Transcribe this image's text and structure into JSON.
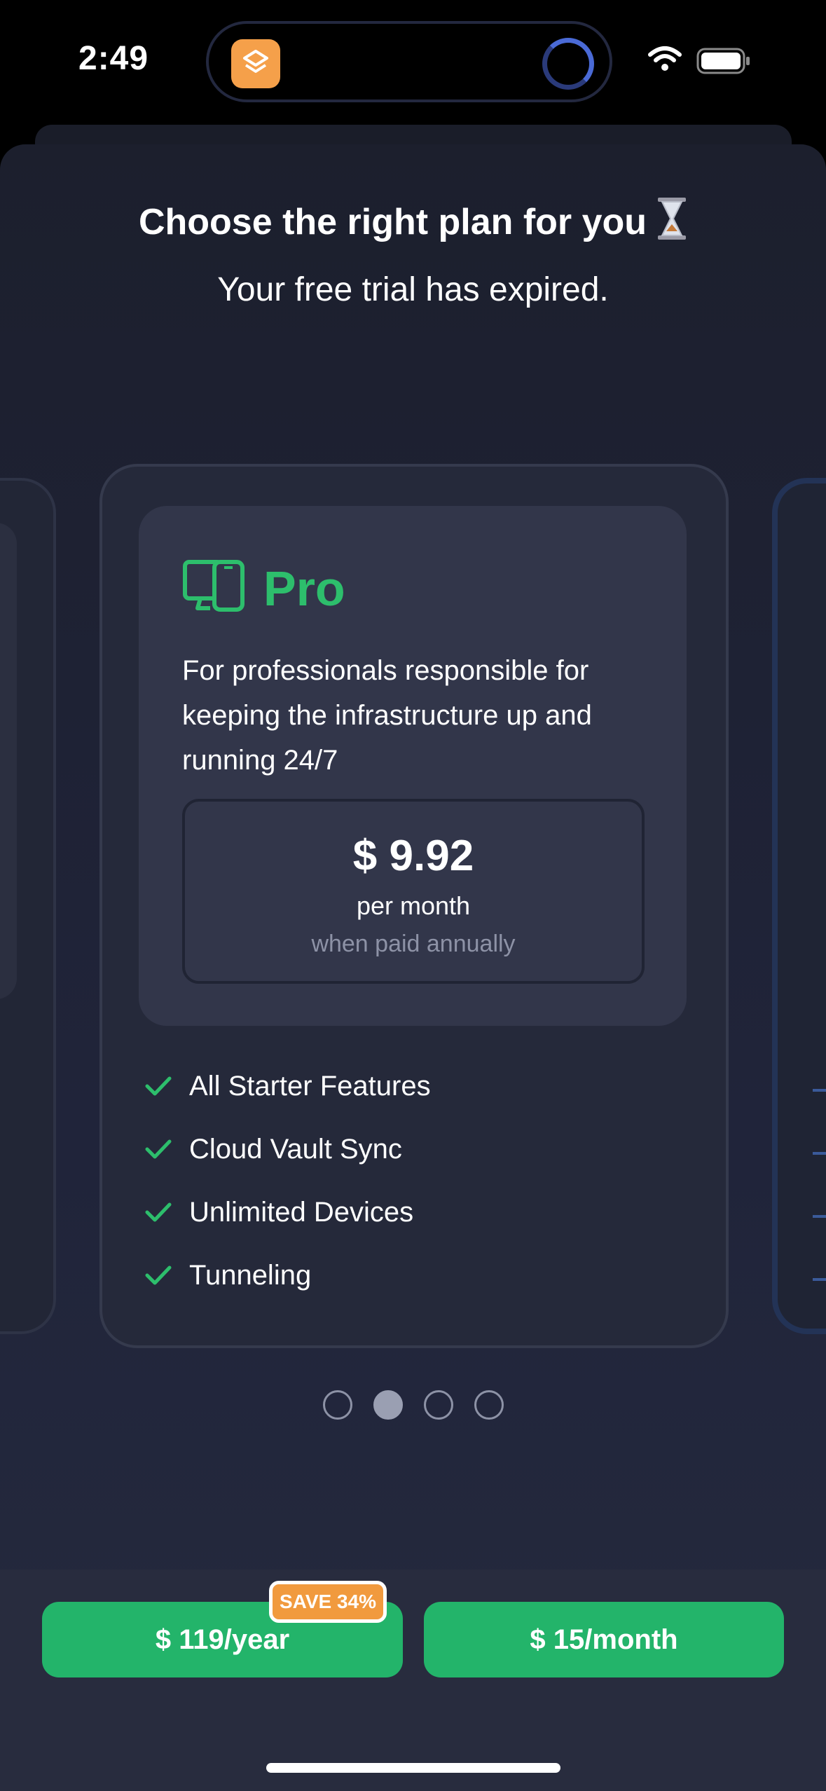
{
  "status_bar": {
    "time": "2:49"
  },
  "header": {
    "title": "Choose the right plan for you",
    "subtitle": "Your free trial has expired."
  },
  "plan": {
    "name": "Pro",
    "description": "For professionals responsible for keeping the infrastructure up and running 24/7",
    "price": "$ 9.92",
    "period": "per month",
    "note": "when paid annually",
    "accent_color": "#2dbe6c",
    "features": [
      "All Starter Features",
      "Cloud Vault Sync",
      "Unlimited Devices",
      "Tunneling"
    ]
  },
  "pagination": {
    "count": 4,
    "active_index": 1
  },
  "purchase": {
    "yearly_label": "$ 119/year",
    "monthly_label": "$ 15/month",
    "save_badge": "SAVE 34%",
    "button_color": "#23b46a",
    "badge_color": "#f19a3e"
  },
  "icons": {
    "plan_icon": "devices-icon",
    "title_icon": "hourglass-icon",
    "feature_icon": "check-icon"
  }
}
